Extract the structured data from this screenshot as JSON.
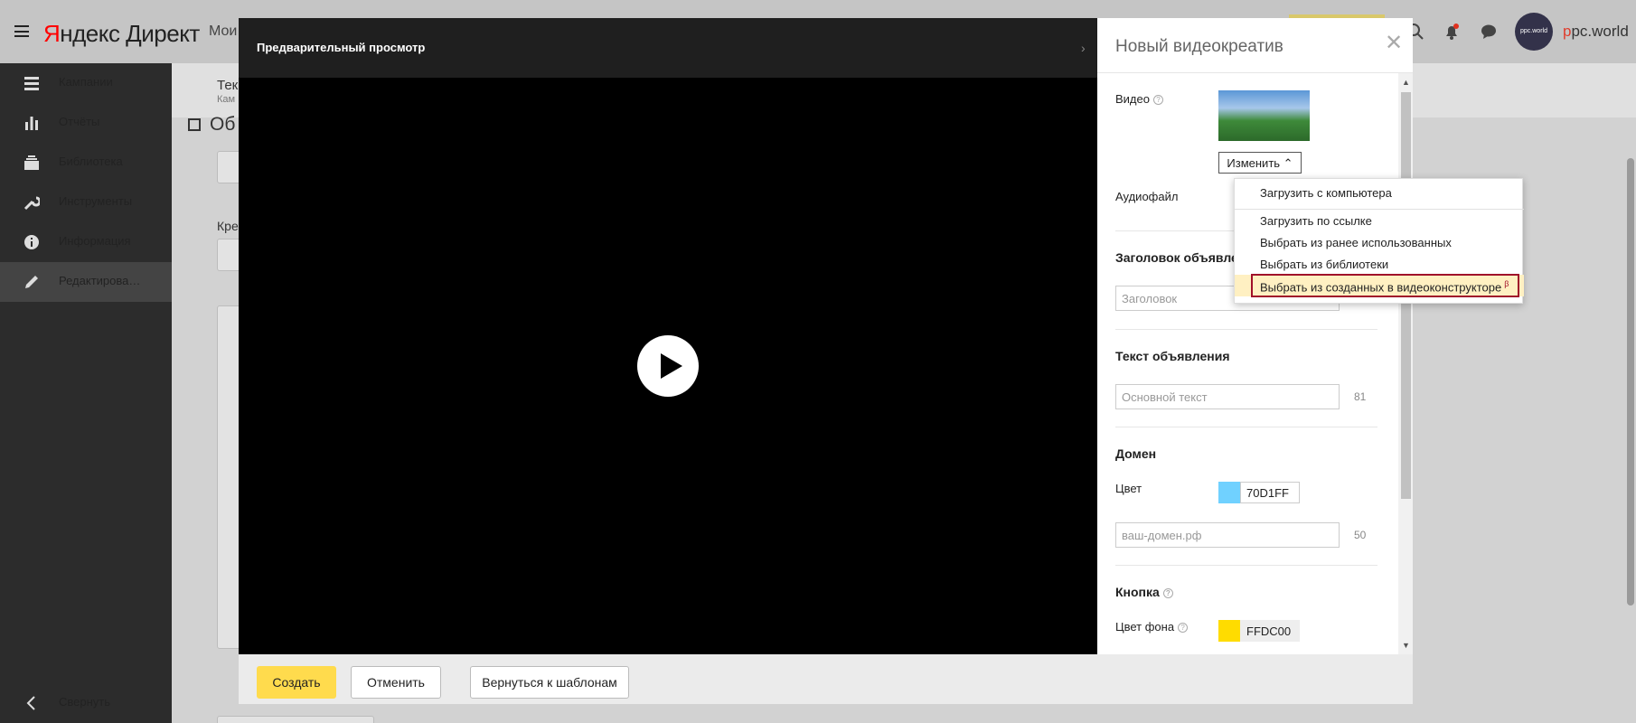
{
  "app": {
    "logo_red": "Я",
    "logo_rest": "ндекс Директ",
    "topbar_text": "Мои",
    "brand_p": "p",
    "brand_rest": "pc.world",
    "avatar_text": "ppc.world"
  },
  "sidebar": {
    "items": [
      {
        "label": "Кампании",
        "icon": "campaigns-icon"
      },
      {
        "label": "Отчёты",
        "icon": "reports-icon"
      },
      {
        "label": "Библиотека",
        "icon": "library-icon"
      },
      {
        "label": "Инструменты",
        "icon": "tools-icon"
      },
      {
        "label": "Информация",
        "icon": "info-icon"
      },
      {
        "label": "Редактирова…",
        "icon": "edit-icon"
      }
    ],
    "collapse_label": "Свернуть"
  },
  "background": {
    "sub_title": "Текс",
    "sub_caption": "Кам",
    "page_heading": "Об",
    "field_label": "Кре"
  },
  "preview": {
    "title": "Предварительный просмотр"
  },
  "panel": {
    "title": "Новый видеокреатив",
    "video_label": "Видео",
    "change_label": "Изменить",
    "audio_label": "Аудиофайл",
    "headline_section": "Заголовок объявле",
    "headline_placeholder": "Заголовок",
    "text_section": "Текст объявления",
    "text_placeholder": "Основной текст",
    "text_counter": "81",
    "domain_section": "Домен",
    "color_label": "Цвет",
    "domain_color_value": "70D1FF",
    "domain_color_hex": "#70D1FF",
    "domain_placeholder": "ваш-домен.рф",
    "domain_counter": "50",
    "button_section": "Кнопка",
    "bg_color_label": "Цвет фона",
    "button_color_value": "FFDC00",
    "button_color_hex": "#FFDC00"
  },
  "dropdown": {
    "items": [
      "Загрузить с компьютера",
      "Загрузить по ссылке",
      "Выбрать из ранее использованных",
      "Выбрать из библиотеки",
      "Выбрать из созданных в видеоконструкторе"
    ],
    "beta_mark": "β"
  },
  "footer": {
    "create_label": "Создать",
    "cancel_label": "Отменить",
    "templates_label": "Вернуться к шаблонам"
  }
}
